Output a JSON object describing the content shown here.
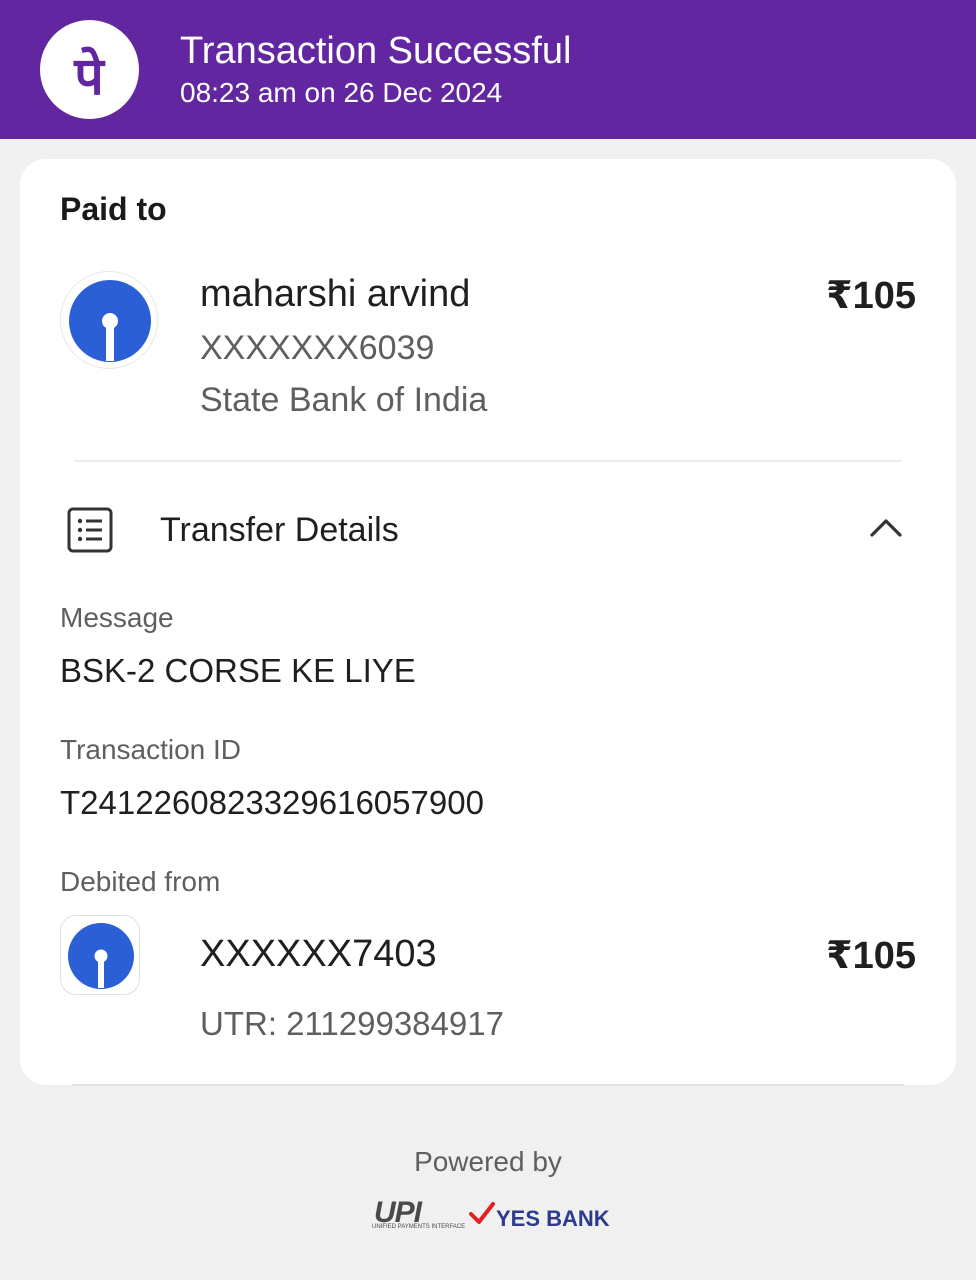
{
  "header": {
    "title": "Transaction Successful",
    "subtitle": "08:23 am on 26 Dec 2024",
    "logo_glyph": "पे",
    "colors": {
      "background": "#6227a0",
      "text": "#ffffff"
    }
  },
  "paid_to": {
    "label": "Paid to",
    "name": "maharshi arvind",
    "account": "XXXXXXX6039",
    "bank": "State Bank of India",
    "amount": "₹105",
    "bank_icon": "sbi-logo-icon"
  },
  "transfer_details": {
    "label": "Transfer Details",
    "expanded": true,
    "message_label": "Message",
    "message_value": "BSK-2 CORSE KE LIYE",
    "transaction_id_label": "Transaction ID",
    "transaction_id_value": "T2412260823329616057900",
    "debited_from_label": "Debited from",
    "debited_account": "XXXXXX7403",
    "debited_amount": "₹105",
    "utr": "UTR: 211299384917"
  },
  "footer": {
    "powered_by": "Powered by",
    "upi_logo": "UPI",
    "upi_subtext": "UNIFIED PAYMENTS INTERFACE",
    "bank_logo": "YES BANK"
  }
}
